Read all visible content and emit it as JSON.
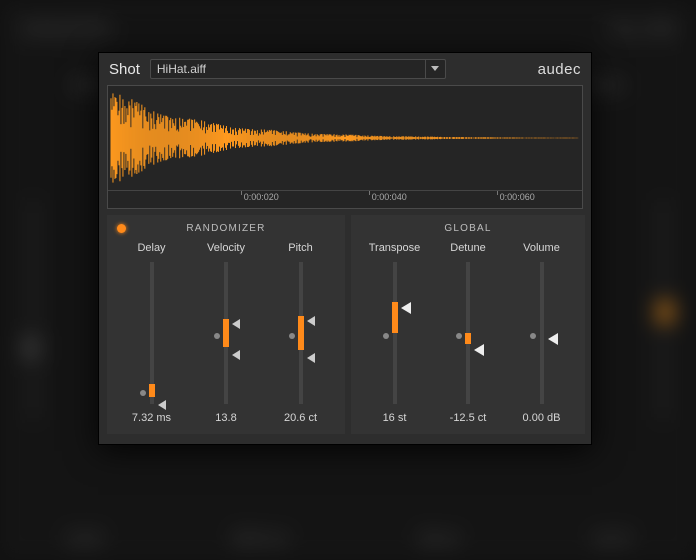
{
  "header": {
    "title": "Shot",
    "file": "HiHat.aiff",
    "brand": "audec"
  },
  "timeline": {
    "ticks": [
      {
        "label": "0:00:020",
        "pos_pct": 28
      },
      {
        "label": "0:00:040",
        "pos_pct": 55
      },
      {
        "label": "0:00:060",
        "pos_pct": 82
      }
    ]
  },
  "randomizer": {
    "title": "RANDOMIZER",
    "enabled": true,
    "params": {
      "delay": {
        "label": "Delay",
        "value": "7.32 ms",
        "dot_pct": 90,
        "fill_top_pct": 86,
        "fill_bot_pct": 95,
        "marker_low_pct": 97
      },
      "velocity": {
        "label": "Velocity",
        "value": "13.8",
        "dot_pct": 50,
        "fill_top_pct": 40,
        "fill_bot_pct": 60,
        "marker_hi_pct": 40,
        "marker_low_pct": 62
      },
      "pitch": {
        "label": "Pitch",
        "value": "20.6 ct",
        "dot_pct": 50,
        "fill_top_pct": 38,
        "fill_bot_pct": 62,
        "marker_hi_pct": 38,
        "marker_low_pct": 64
      }
    }
  },
  "global": {
    "title": "GLOBAL",
    "params": {
      "transpose": {
        "label": "Transpose",
        "value": "16 st",
        "dot_pct": 50,
        "fill_top_pct": 28,
        "fill_bot_pct": 50,
        "marker_pct": 28
      },
      "detune": {
        "label": "Detune",
        "value": "-12.5 ct",
        "dot_pct": 50,
        "fill_top_pct": 50,
        "fill_bot_pct": 58,
        "marker_pct": 58
      },
      "volume": {
        "label": "Volume",
        "value": "0.00 dB",
        "dot_pct": 50,
        "marker_pct": 50
      }
    }
  }
}
